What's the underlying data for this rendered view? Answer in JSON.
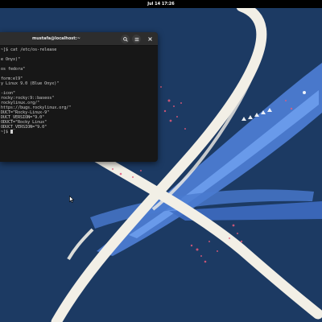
{
  "topbar": {
    "clock": "Jul 14  17:26"
  },
  "terminal": {
    "title": "mustafa@localhost:~",
    "lines": [
      "~]$ cat /etc/os-release",
      "",
      "e Onyx)\"",
      "",
      "os fedora\"",
      "",
      "form:el9\"",
      "y Linux 9.0 (Blue Onyx)\"",
      "",
      "-icon\"",
      "rocky:rocky:9::baseos\"",
      "rockylinux.org/\"",
      "https://bugs.rockylinux.org/\"",
      "DUCT=\"Rocky-Linux-9\"",
      "DUCT_VERSION=\"9.0\"",
      "ODUCT=\"Rocky Linux\"",
      "ODUCT_VERSION=\"9.0\"",
      "~]$ "
    ]
  },
  "colors": {
    "desktop_background": "#1c3a63",
    "ribbon": "#f2efe6",
    "terminal_background": "#171717",
    "terminal_header": "#2d2d2d",
    "topbar": "#000000"
  }
}
